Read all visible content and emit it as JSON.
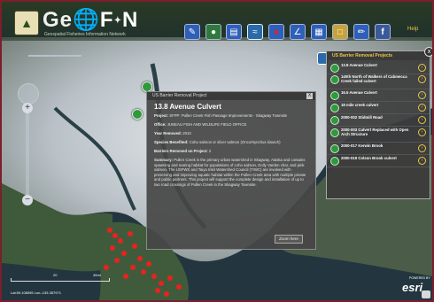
{
  "header": {
    "brand_prefix": "Ge",
    "brand_suffix": "F",
    "brand_end": "N",
    "tagline": "Geospatial Fisheries Information Network",
    "help_label": "Help"
  },
  "popup": {
    "window_title": "US Barrier Removal Project",
    "close_label": "X",
    "heading": "13.8 Avenue Culvert",
    "project_label": "Project:",
    "project_value": "SFPP: Pullen Creek Fish Passage Improvements - Skagway Townsite",
    "office_label": "Office:",
    "office_value": "JUNEAU FISH AND WILDLIFE FIELD OFFICE",
    "year_label": "Year Removed:",
    "year_value": "2010",
    "species_label": "Species Benefited:",
    "species_value": "Coho salmon or silver salmon (Oncorhynchus kisutch)",
    "barriers_label": "Barriers Removed on Project:",
    "barriers_value": "2",
    "summary_label": "Summary:",
    "summary_value": "Pullen Creek is the primary urban watershed in Skagway, Alaska and contains spawning and rearing habitat for populations of coho salmon, Dolly Varden char, and pink salmon. The USFWS and Taiya Inlet Watershed Council (TIWC) are involved with preserving and improving aquatic habitat within the Pullen Creek area with multiple private and public partners. This project will support the complete design and installation of up to two road crossings of Pullen Creek in the Skagway Townsite.",
    "zoom_here_label": "Zoom here"
  },
  "projects_panel": {
    "title": "US Barrier Removal Projects",
    "close_label": "x",
    "go_glyph": "›",
    "items": [
      {
        "label": "13.8 Avenue Culvert"
      },
      {
        "label": "140th North of Walkers of Cabmecca Creek failed culvert"
      },
      {
        "label": "16.5 Avenue Culvert"
      },
      {
        "label": "18 mile creek culvert"
      },
      {
        "label": "2000-002 Stidmill Road"
      },
      {
        "label": "2000-003 Culvert Replaced with Open Arch Structure"
      },
      {
        "label": "2000-017 Kerwin Brook"
      },
      {
        "label": "2000-019 Colson Brook culvert"
      }
    ]
  },
  "map": {
    "scale_label_1": "20",
    "scale_label_2": "40mi",
    "coords": "Lat:59.108595  Lon:-135.357971",
    "esri_label": "esri",
    "powered_by": "POWERED BY"
  },
  "colors": {
    "frame_border": "#7a1f2b",
    "marker_green": "#2f9a3c",
    "barrier_red": "#e8221e",
    "accent_gold": "#e8c84a"
  }
}
